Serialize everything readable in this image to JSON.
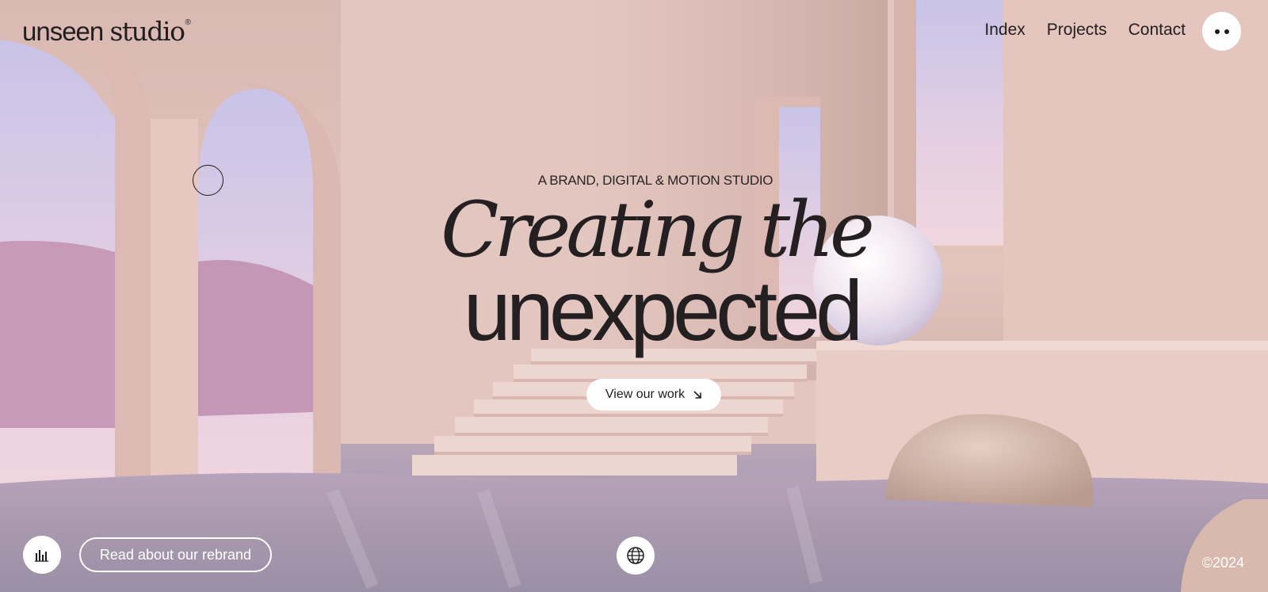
{
  "brand": {
    "name_part1": "unseen",
    "name_part2": "studio",
    "mark": "®"
  },
  "nav": {
    "items": [
      "Index",
      "Projects",
      "Contact"
    ]
  },
  "menu_button": {
    "icon": "two-dots-icon"
  },
  "hero": {
    "tagline": "A BRAND, DIGITAL & MOTION STUDIO",
    "headline_line1": "Creating the",
    "headline_line2": "unexpected",
    "cta_label": "View our work",
    "cta_icon": "arrow-down-right-icon"
  },
  "footer": {
    "stats_icon": "bar-chart-icon",
    "rebrand_label": "Read about our rebrand",
    "globe_icon": "globe-icon",
    "copyright": "©2024"
  },
  "colors": {
    "accent_white": "#ffffff",
    "text_dark": "#1f1b1c",
    "background_blush": "#e2c4bd"
  }
}
